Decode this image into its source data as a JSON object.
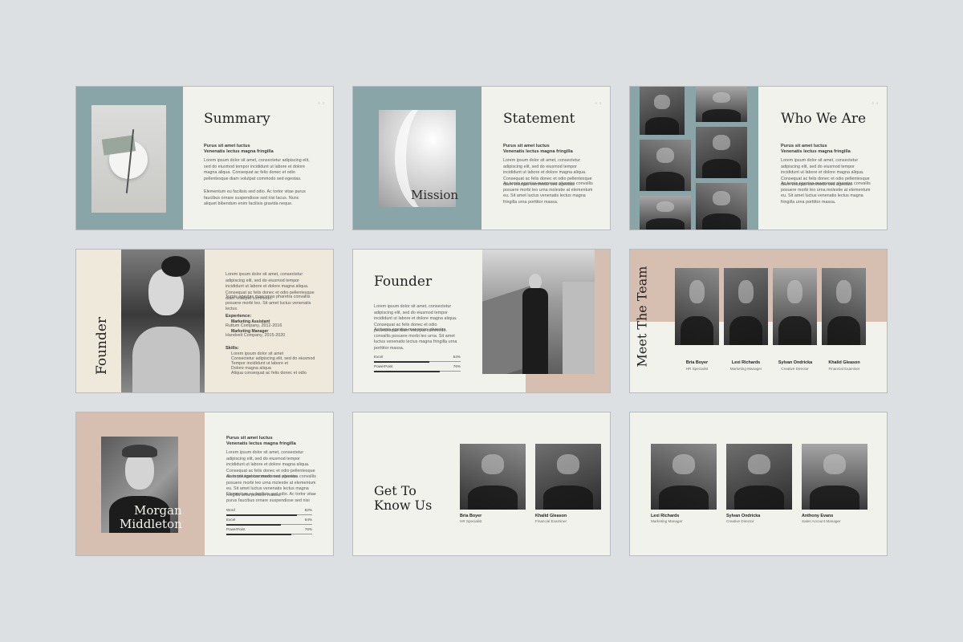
{
  "lorem": {
    "sub": "Purus sit amet luctus",
    "sub2": "Venenatis lectus magna fringilla",
    "p1": "Lorem ipsum dolor sit amet, consectetur adipiscing elit, sed do eiusmod tempor incididunt ut labore et dolore magna aliqua. Consequat ac felis donec et odio pellentesque diam volutpat commodo sed egestas.",
    "p2": "Ac turpis egestas maecenas pharetra convallis posuere morbi leo urna molestie at elementum eu. Sit amet luctus venenatis lectus magna fringilla urna porttitor massa.",
    "p3": "Elementum eu facilisis sed odio. Ac tortor vitae purus faucibus ornare suspendisse sed nisi lacus. Nunc aliquet bibendum enim facilisis gravida neque."
  },
  "slides": {
    "summary": {
      "title": "Summary",
      "page": "0 2"
    },
    "mission": {
      "title": "Statement",
      "overlay": "Mission",
      "page": "0 3"
    },
    "who": {
      "title": "Who We Are",
      "page": "0 4"
    },
    "founder1": {
      "title": "Founder",
      "p_a": "Lorem ipsum dolor sit amet, consectetur adipiscing elit, sed do eiusmod tempor incididunt ut labore et dolore magna aliqua. Consequat ac felis donec et odio pellentesque diam volutpat commodo.",
      "p_b": "Turpis egestas maecenas pharetra convallis posuere morbi leo. Sit amet luctus venenatis lectus.",
      "exp_h": "Experience:",
      "exp": [
        "Marketing Assistant",
        "Ruttum Company, 2012-2016",
        "Marketing Manager",
        "Handvelt Company, 2015-2020"
      ],
      "skills_h": "Skills:",
      "skills": [
        "Lorem ipsum dolor sit amet",
        "Consectetur adipiscing elit, sed do eiusmod",
        "Tempor incididunt ut labore et",
        "Dolore magna aliqua",
        "Aliqua consequat ac felis donec et odio"
      ]
    },
    "founder2": {
      "title": "Founder",
      "p_a": "Lorem ipsum dolor sit amet, consectetur adipiscing elit, sed do eiusmod tempor incididunt ut labore et dolore magna aliqua. Consequat ac felis donec et odio pellentesque diam volutpat commodo.",
      "p_b": "Ac turpis egestas maecenas pharetra convallis posuere morbi leo urna. Sit amet luctus venenatis lectus magna fringilla urna porttitor massa.",
      "skills": [
        {
          "label": "Excel",
          "value": "64%",
          "pct": 64
        },
        {
          "label": "PowerPoint",
          "value": "76%",
          "pct": 76
        }
      ]
    },
    "team": {
      "title": "Meet The Team",
      "members": [
        {
          "name": "Bria Boyer",
          "role": "HR Specialist"
        },
        {
          "name": "Lexi Richards",
          "role": "Marketing Manager"
        },
        {
          "name": "Sylvan Ondricka",
          "role": "Creative Director"
        },
        {
          "name": "Khalid Gleason",
          "role": "Financial Examiner"
        }
      ]
    },
    "morgan": {
      "name1": "Morgan",
      "name2": "Middleton",
      "skills": [
        {
          "label": "Word",
          "value": "82%",
          "pct": 82
        },
        {
          "label": "Excel",
          "value": "64%",
          "pct": 64
        },
        {
          "label": "PowerPoint",
          "value": "76%",
          "pct": 76
        }
      ]
    },
    "know": {
      "title1": "Get To",
      "title2": "Know Us",
      "members": [
        {
          "name": "Bria Boyer",
          "role": "HR Specialist"
        },
        {
          "name": "Khalid Gleason",
          "role": "Financial Examiner"
        }
      ]
    },
    "three": {
      "members": [
        {
          "name": "Lexi Richards",
          "role": "Marketing Manager"
        },
        {
          "name": "Sylvan Ondricka",
          "role": "Creative Director"
        },
        {
          "name": "Anthony Evans",
          "role": "Sales Account Manager"
        }
      ]
    }
  },
  "colors": {
    "teal": "#8aa5a7",
    "blush": "#d6beb1",
    "cream": "#efe9db",
    "paper": "#f2f2ed",
    "bg": "#dce0e3"
  }
}
